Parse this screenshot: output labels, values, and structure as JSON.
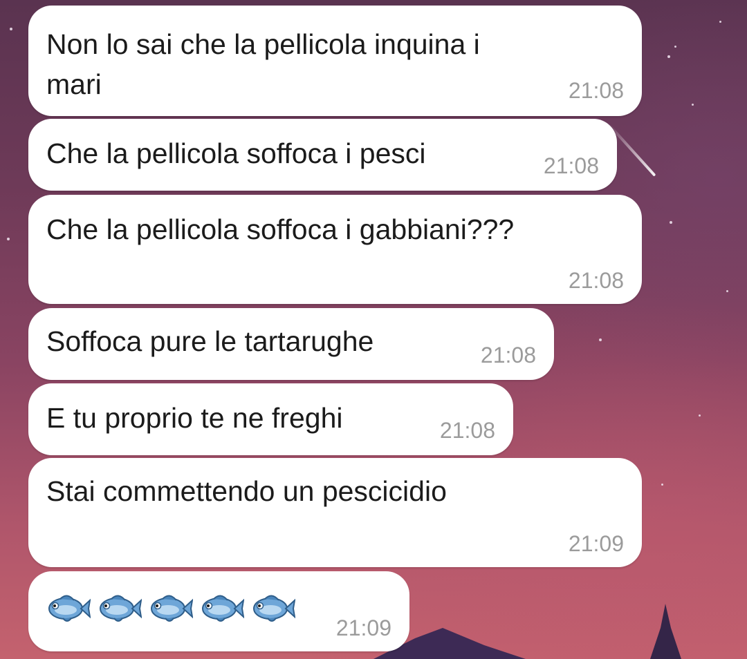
{
  "chat": {
    "messages": [
      {
        "text_lines": [
          "Non lo sai che la pellicola inquina i",
          "mari"
        ],
        "time": "21:08"
      },
      {
        "text": "Che la pellicola soffoca i pesci",
        "time": "21:08"
      },
      {
        "text": "Che la pellicola soffoca i gabbiani???",
        "time": "21:08"
      },
      {
        "text": "Soffoca pure le tartarughe",
        "time": "21:08"
      },
      {
        "text": "E tu proprio te ne freghi",
        "time": "21:08"
      },
      {
        "text": "Stai commettendo un pescicidio",
        "time": "21:09"
      },
      {
        "emoji": [
          "fish-emoji",
          "fish-emoji",
          "fish-emoji",
          "fish-emoji",
          "fish-emoji"
        ],
        "time": "21:09"
      }
    ]
  },
  "theme": {
    "bubble_color": "#ffffff",
    "text_color": "#1b1b1b",
    "time_color": "#9b9b9b",
    "fish_color": "#6ea6d8"
  }
}
